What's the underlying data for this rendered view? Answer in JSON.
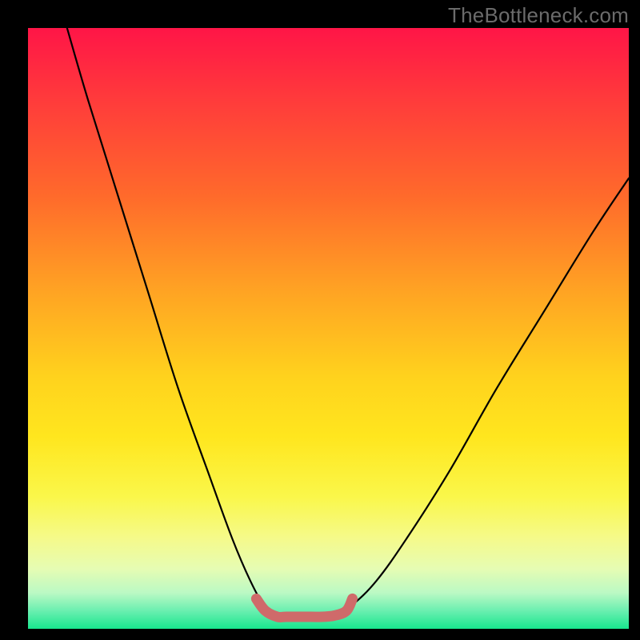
{
  "watermark": "TheBottleneck.com",
  "colors": {
    "curve_stroke": "#000000",
    "highlight_stroke": "#cf6a6a",
    "frame": "#000000"
  },
  "chart_data": {
    "type": "line",
    "title": "",
    "xlabel": "",
    "ylabel": "",
    "xlim": [
      0,
      100
    ],
    "ylim": [
      0,
      100
    ],
    "grid": false,
    "series": [
      {
        "name": "left-curve",
        "x": [
          6.5,
          10,
          15,
          20,
          25,
          30,
          34,
          37,
          39.5,
          41.5,
          43
        ],
        "values": [
          100,
          88,
          72,
          56,
          40,
          26,
          15,
          8,
          3.5,
          2,
          2
        ]
      },
      {
        "name": "right-curve",
        "x": [
          49,
          51,
          54,
          58,
          63,
          70,
          78,
          86,
          94,
          100
        ],
        "values": [
          2,
          2.2,
          4,
          8,
          15,
          26,
          40,
          53,
          66,
          75
        ]
      },
      {
        "name": "bottom-highlight",
        "x": [
          38,
          39.5,
          41.5,
          43,
          46,
          49,
          51,
          53,
          54
        ],
        "values": [
          5,
          3,
          2,
          2,
          2,
          2,
          2.2,
          3,
          5
        ]
      }
    ]
  }
}
